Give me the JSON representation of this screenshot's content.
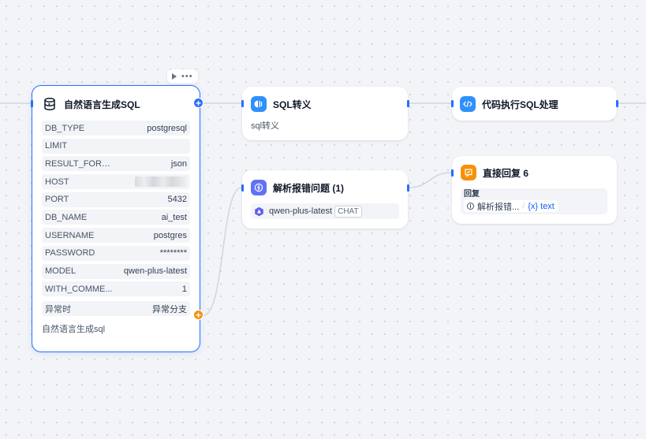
{
  "colors": {
    "accent": "#296dff",
    "orange": "#f79009",
    "edge": "#d0d5dd",
    "llm": "#6172f3"
  },
  "node_nl_sql": {
    "title": "自然语言生成SQL",
    "icon": "database-icon",
    "params": [
      {
        "key": "DB_TYPE",
        "value": "postgresql"
      },
      {
        "key": "LIMIT",
        "value": ""
      },
      {
        "key": "RESULT_FORMAT",
        "value": "json"
      },
      {
        "key": "HOST",
        "value": "",
        "redacted": true
      },
      {
        "key": "PORT",
        "value": "5432"
      },
      {
        "key": "DB_NAME",
        "value": "ai_test"
      },
      {
        "key": "USERNAME",
        "value": "postgres"
      },
      {
        "key": "PASSWORD",
        "value": "********"
      },
      {
        "key": "MODEL",
        "value": "qwen-plus-latest"
      },
      {
        "key": "WITH_COMME...",
        "value": "1"
      }
    ],
    "exception_label": "异常时",
    "exception_value": "异常分支",
    "description": "自然语言生成sql"
  },
  "node_sql_escape": {
    "title": "SQL转义",
    "icon": "knowledge-icon",
    "subtitle": "sql转义"
  },
  "node_code_exec": {
    "title": "代码执行SQL处理",
    "icon": "code-icon"
  },
  "node_parse_error": {
    "title": "解析报错问题 (1)",
    "icon": "llm-icon",
    "model_name": "qwen-plus-latest",
    "model_tag": "CHAT"
  },
  "node_reply": {
    "title": "直接回复 6",
    "icon": "reply-icon",
    "reply_label": "回复",
    "ref_node": "解析报错...",
    "ref_separator": "/",
    "ref_var": "{x} text"
  },
  "toolbar": {
    "run_icon": "play-icon",
    "more_icon": "more-icon"
  }
}
